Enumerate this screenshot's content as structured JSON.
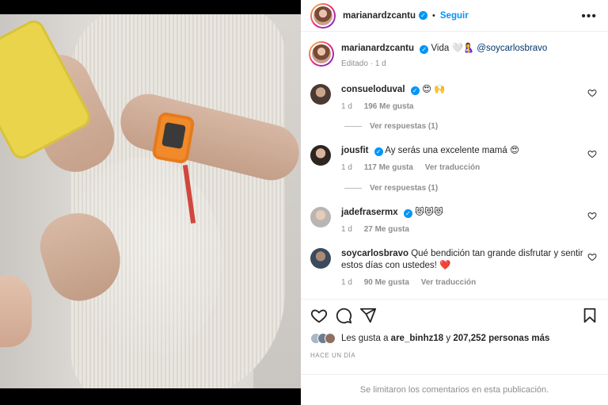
{
  "post": {
    "author": "marianardzcantu",
    "follow_label": "Seguir",
    "more_label": "•••",
    "caption_text": "Vida 🤍🤱",
    "caption_mention": "@soycarlosbravo",
    "edited_label": "Editado",
    "edited_time": "1 d"
  },
  "comments": [
    {
      "user": "consueloduval",
      "verified": true,
      "text": "😍 🙌",
      "time": "1 d",
      "likes": "196 Me gusta",
      "translate": "",
      "replies": "Ver respuestas (1)"
    },
    {
      "user": "jousfit",
      "verified": true,
      "text": "Ay serás una excelente mamá 😍",
      "time": "1 d",
      "likes": "117 Me gusta",
      "translate": "Ver traducción",
      "replies": "Ver respuestas (1)"
    },
    {
      "user": "jadefrasermx",
      "verified": true,
      "text": "😻😻😻",
      "time": "1 d",
      "likes": "27 Me gusta",
      "translate": "",
      "replies": ""
    },
    {
      "user": "soycarlosbravo",
      "verified": false,
      "text": "Qué bendición tan grande disfrutar y sentir estos días con ustedes! ❤️",
      "time": "1 d",
      "likes": "90 Me gusta",
      "translate": "Ver traducción",
      "replies": ""
    }
  ],
  "likes": {
    "prefix": "Les gusta a",
    "user": "are_binhz18",
    "connector": "y",
    "count": "207,252 personas más"
  },
  "date_label": "HACE UN DÍA",
  "footer_text": "Se limitaron los comentarios en esta publicación.",
  "icons": [
    "heart-icon",
    "comment-icon",
    "share-icon",
    "bookmark-icon",
    "more-icon",
    "verified-icon"
  ],
  "colors": {
    "accent": "#0095f6",
    "text": "#262626",
    "muted": "#8e8e8e",
    "border": "#efefef",
    "heart_red": "#ed4956"
  }
}
